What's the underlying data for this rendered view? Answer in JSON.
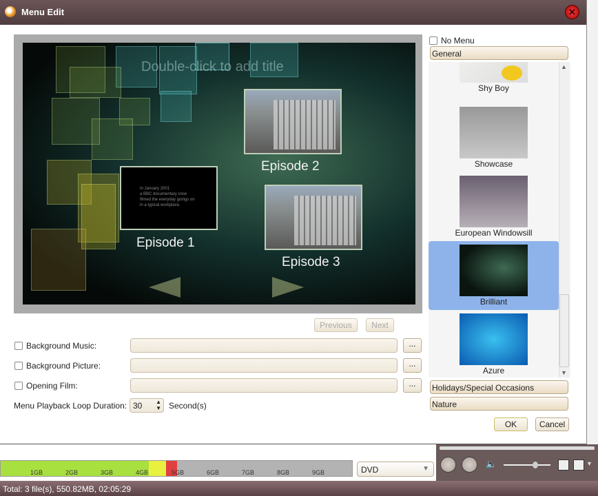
{
  "window": {
    "title": "Menu Edit",
    "close_icon": "close-icon"
  },
  "preview": {
    "title_placeholder": "Double-click to add title",
    "episodes": [
      {
        "label": "Episode 1",
        "text": "In January 2001\na BBC documentary crew\nfilmed the everyday goings on\nin a typical workplace."
      },
      {
        "label": "Episode 2"
      },
      {
        "label": "Episode 3"
      }
    ],
    "prev_arrow": "arrow-left-icon",
    "next_arrow": "arrow-right-icon"
  },
  "nav": {
    "previous": "Previous",
    "next": "Next"
  },
  "options": {
    "background_music": {
      "label": "Background Music:",
      "value": "",
      "browse": "..."
    },
    "background_picture": {
      "label": "Background Picture:",
      "value": "",
      "browse": "..."
    },
    "opening_film": {
      "label": "Opening Film:",
      "value": "",
      "browse": "..."
    },
    "loop": {
      "label": "Menu Playback Loop Duration:",
      "value": "30",
      "unit": "Second(s)"
    }
  },
  "templates": {
    "no_menu": "No Menu",
    "categories": [
      "General",
      "Holidays/Special Occasions",
      "Nature"
    ],
    "items": [
      {
        "name": "Shy Boy",
        "selected": false
      },
      {
        "name": "Showcase",
        "selected": false
      },
      {
        "name": "European Windowsill",
        "selected": false
      },
      {
        "name": "Brilliant",
        "selected": true
      },
      {
        "name": "Azure",
        "selected": false
      }
    ]
  },
  "dialog_buttons": {
    "ok": "OK",
    "cancel": "Cancel"
  },
  "storage": {
    "ticks": [
      "1GB",
      "2GB",
      "3GB",
      "4GB",
      "5GB",
      "6GB",
      "7GB",
      "8GB",
      "9GB"
    ],
    "used_gb": 4.2,
    "colors": {
      "used": "#a8e040",
      "warn": "#e8f040",
      "limit": "#e04040",
      "free": "#b3b3b3"
    }
  },
  "disc_type": "DVD",
  "status": "Total: 3 file(s), 550.82MB,  02:05:29"
}
